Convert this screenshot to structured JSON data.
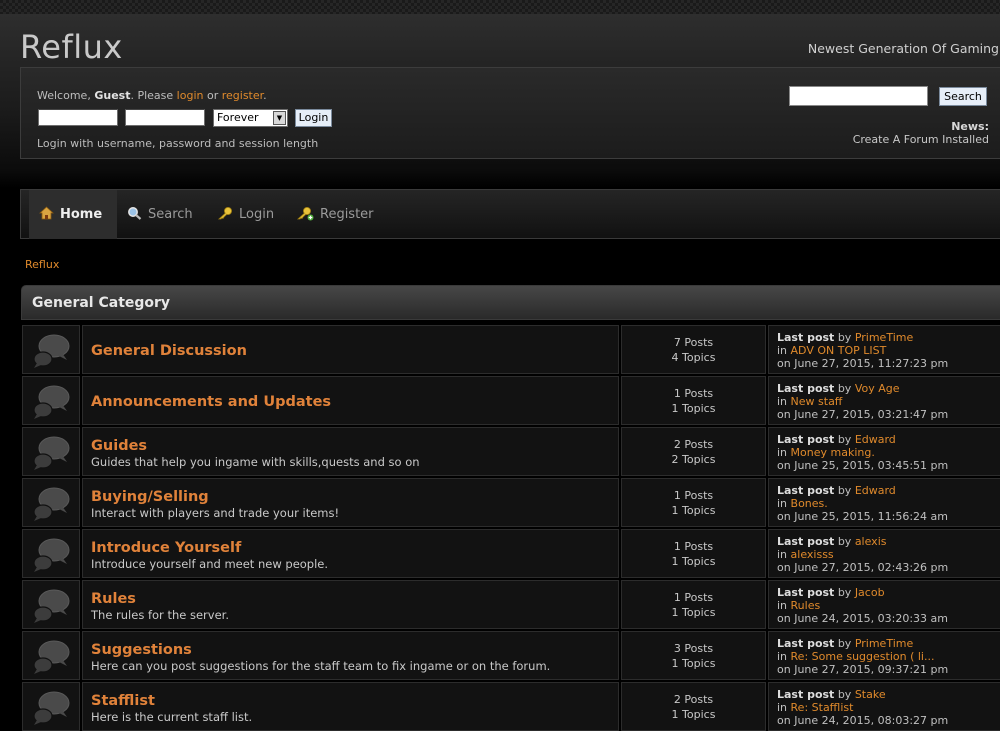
{
  "header": {
    "site_title": "Reflux",
    "tagline": "Newest Generation Of Gaming"
  },
  "userbox": {
    "welcome": "Welcome,",
    "guest": "Guest",
    "please": ". Please",
    "login_link": "login",
    "or": "or",
    "register_link": "register",
    "period": ".",
    "session_option": "Forever",
    "login_button": "Login",
    "hint": "Login with username, password and session length",
    "search_button": "Search",
    "news_title": "News:",
    "news_text": "Create A Forum Installed"
  },
  "nav": [
    {
      "label": "Home",
      "icon": "home-icon",
      "active": true
    },
    {
      "label": "Search",
      "icon": "search-icon"
    },
    {
      "label": "Login",
      "icon": "key-icon"
    },
    {
      "label": "Register",
      "icon": "register-key-icon"
    }
  ],
  "breadcrumb": "Reflux",
  "category": {
    "title": "General Category"
  },
  "labels": {
    "last_post": "Last post",
    "by": "by",
    "in": "in",
    "on": "on"
  },
  "boards": [
    {
      "title": "General Discussion",
      "desc": "",
      "posts": "7 Posts",
      "topics": "4 Topics",
      "last_by": "PrimeTime",
      "last_in": "ADV ON TOP LIST",
      "last_on": "June 27, 2015, 11:27:23 pm"
    },
    {
      "title": "Announcements and Updates",
      "desc": "",
      "posts": "1 Posts",
      "topics": "1 Topics",
      "last_by": "Voy Age",
      "last_in": "New staff",
      "last_on": "June 27, 2015, 03:21:47 pm"
    },
    {
      "title": "Guides",
      "desc": "Guides that help you ingame with skills,quests and so on",
      "posts": "2 Posts",
      "topics": "2 Topics",
      "last_by": "Edward",
      "last_in": "Money making.",
      "last_on": "June 25, 2015, 03:45:51 pm"
    },
    {
      "title": "Buying/Selling",
      "desc": "Interact with players and trade your items!",
      "posts": "1 Posts",
      "topics": "1 Topics",
      "last_by": "Edward",
      "last_in": "Bones.",
      "last_on": "June 25, 2015, 11:56:24 am"
    },
    {
      "title": "Introduce Yourself",
      "desc": "Introduce yourself and meet new people.",
      "posts": "1 Posts",
      "topics": "1 Topics",
      "last_by": "alexis",
      "last_in": "alexisss",
      "last_on": "June 27, 2015, 02:43:26 pm"
    },
    {
      "title": "Rules",
      "desc": "The rules for the server.",
      "posts": "1 Posts",
      "topics": "1 Topics",
      "last_by": "Jacob",
      "last_in": "Rules",
      "last_on": "June 24, 2015, 03:20:33 am"
    },
    {
      "title": "Suggestions",
      "desc": "Here can you post suggestions for the staff team to fix ingame or on the forum.",
      "posts": "3 Posts",
      "topics": "1 Topics",
      "last_by": "PrimeTime",
      "last_in": "Re: Some suggestion ( li...",
      "last_on": "June 27, 2015, 09:37:21 pm"
    },
    {
      "title": "Stafflist",
      "desc": "Here is the current staff list.",
      "posts": "2 Posts",
      "topics": "1 Topics",
      "last_by": "Stake",
      "last_in": "Re: Stafflist",
      "last_on": "June 24, 2015, 08:03:27 pm"
    }
  ]
}
